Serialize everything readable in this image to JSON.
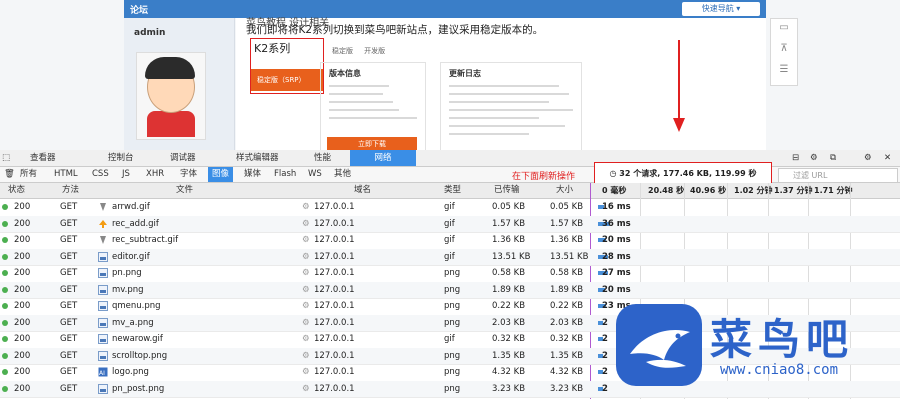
{
  "page": {
    "forum_label": "论坛",
    "quick_nav": "快速导航 ▾",
    "username": "admin",
    "notice_line1": "菜鸟教程 设计相关",
    "notice_line2": "我们即将将K2系列切换到菜鸟吧新站点，建议采用稳定版本的。",
    "k2_title": "K2系列",
    "k2_button": "稳定版（SRP）",
    "tab_a": "稳定版",
    "tab_b": "开发版",
    "panel1_title": "版本信息",
    "panel2_title": "更新日志",
    "download_button": "立即下载"
  },
  "devtools": {
    "tabs": [
      "查看器",
      "控制台",
      "调试器",
      "样式编辑器",
      "性能",
      "网络"
    ],
    "active_tab": "网络",
    "filters": [
      "所有",
      "HTML",
      "CSS",
      "JS",
      "XHR",
      "字体",
      "图像",
      "媒体",
      "Flash",
      "WS",
      "其他"
    ],
    "active_filter": "图像",
    "annotation": "在下面刷新操作",
    "summary": "32 个请求, 177.46 KB, 119.99 秒",
    "url_filter_placeholder": "过滤 URL",
    "columns": {
      "status": "状态",
      "method": "方法",
      "file": "文件",
      "domain": "域名",
      "type": "类型",
      "transferred": "已传输",
      "size": "大小"
    },
    "timeline_labels": [
      "0 毫秒",
      "20.48 秒",
      "40.96 秒",
      "1.02 分钟",
      "1.37 分钟",
      "1.71 分钟"
    ],
    "rows": [
      {
        "status": "200",
        "method": "GET",
        "file": "arrwd.gif",
        "domain": "127.0.0.1",
        "type": "gif",
        "transferred": "0.05 KB",
        "size": "0.05 KB",
        "time": "16 ms",
        "icon": "down-arrow-icon"
      },
      {
        "status": "200",
        "method": "GET",
        "file": "rec_add.gif",
        "domain": "127.0.0.1",
        "type": "gif",
        "transferred": "1.57 KB",
        "size": "1.57 KB",
        "time": "36 ms",
        "icon": "up-arrow-icon"
      },
      {
        "status": "200",
        "method": "GET",
        "file": "rec_subtract.gif",
        "domain": "127.0.0.1",
        "type": "gif",
        "transferred": "1.36 KB",
        "size": "1.36 KB",
        "time": "20 ms",
        "icon": "down-arrow-icon"
      },
      {
        "status": "200",
        "method": "GET",
        "file": "editor.gif",
        "domain": "127.0.0.1",
        "type": "gif",
        "transferred": "13.51 KB",
        "size": "13.51 KB",
        "time": "28 ms",
        "icon": "image-icon"
      },
      {
        "status": "200",
        "method": "GET",
        "file": "pn.png",
        "domain": "127.0.0.1",
        "type": "png",
        "transferred": "0.58 KB",
        "size": "0.58 KB",
        "time": "27 ms",
        "icon": "image-icon"
      },
      {
        "status": "200",
        "method": "GET",
        "file": "mv.png",
        "domain": "127.0.0.1",
        "type": "png",
        "transferred": "1.89 KB",
        "size": "1.89 KB",
        "time": "20 ms",
        "icon": "image-icon"
      },
      {
        "status": "200",
        "method": "GET",
        "file": "qmenu.png",
        "domain": "127.0.0.1",
        "type": "png",
        "transferred": "0.22 KB",
        "size": "0.22 KB",
        "time": "23 ms",
        "icon": "image-icon"
      },
      {
        "status": "200",
        "method": "GET",
        "file": "mv_a.png",
        "domain": "127.0.0.1",
        "type": "png",
        "transferred": "2.03 KB",
        "size": "2.03 KB",
        "time": "2",
        "icon": "image-icon"
      },
      {
        "status": "200",
        "method": "GET",
        "file": "newarow.gif",
        "domain": "127.0.0.1",
        "type": "gif",
        "transferred": "0.32 KB",
        "size": "0.32 KB",
        "time": "2",
        "icon": "image-icon"
      },
      {
        "status": "200",
        "method": "GET",
        "file": "scrolltop.png",
        "domain": "127.0.0.1",
        "type": "png",
        "transferred": "1.35 KB",
        "size": "1.35 KB",
        "time": "2",
        "icon": "image-icon"
      },
      {
        "status": "200",
        "method": "GET",
        "file": "logo.png",
        "domain": "127.0.0.1",
        "type": "png",
        "transferred": "4.32 KB",
        "size": "4.32 KB",
        "time": "2",
        "icon": "logo-icon"
      },
      {
        "status": "200",
        "method": "GET",
        "file": "pn_post.png",
        "domain": "127.0.0.1",
        "type": "png",
        "transferred": "3.23 KB",
        "size": "3.23 KB",
        "time": "2",
        "icon": "image-icon"
      }
    ]
  },
  "watermark": {
    "text": "菜鸟吧",
    "url": "www.cniao8.com"
  }
}
